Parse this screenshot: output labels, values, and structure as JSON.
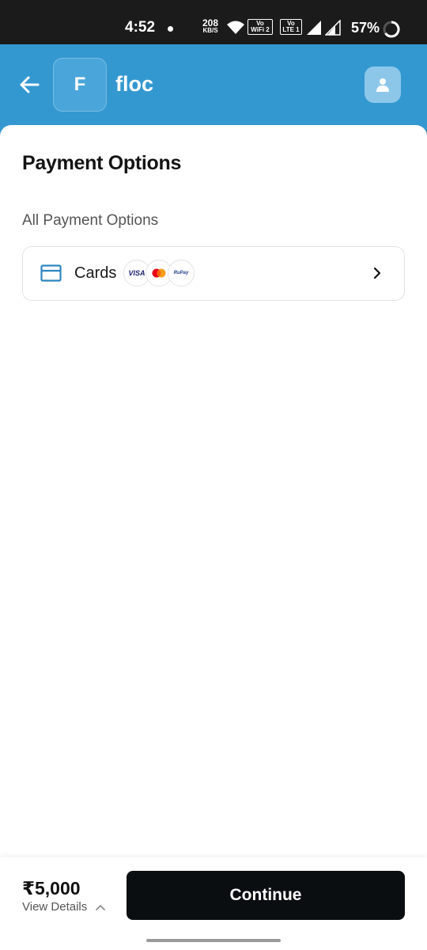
{
  "status_bar": {
    "time": "4:52",
    "net_speed_value": "208",
    "net_speed_unit": "KB/S",
    "volte1_top": "Vo",
    "volte1_bottom": "WiFi 2",
    "volte2_top": "Vo",
    "volte2_bottom": "LTE 1",
    "battery": "57%"
  },
  "header": {
    "merchant_initial": "F",
    "merchant_name": "floc",
    "back_icon": "arrow-left-icon",
    "profile_icon": "user-icon",
    "background_color": "#3498d0"
  },
  "main": {
    "title": "Payment Options",
    "section_label": "All Payment Options",
    "options": [
      {
        "label": "Cards",
        "icon": "credit-card-icon",
        "brands": [
          "VISA",
          "Mastercard",
          "RuPay"
        ]
      }
    ]
  },
  "footer": {
    "amount": "₹5,000",
    "view_details": "View Details",
    "continue_label": "Continue"
  }
}
